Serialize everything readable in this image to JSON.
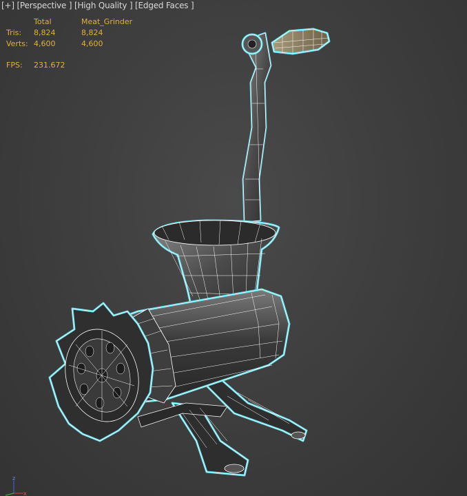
{
  "viewport": {
    "label_parts": [
      "[+]",
      "[Perspective ]",
      "[High Quality ]",
      "[Edged Faces ]"
    ]
  },
  "stats": {
    "header": {
      "total": "Total",
      "object": "Meat_Grinder"
    },
    "rows": [
      {
        "label": "Tris:",
        "total": "8,824",
        "object": "8,824"
      },
      {
        "label": "Verts:",
        "total": "4,600",
        "object": "4,600"
      }
    ],
    "fps": {
      "label": "FPS:",
      "value": "231.672"
    }
  },
  "gizmo": {
    "axes": [
      "z",
      "x"
    ]
  },
  "colors": {
    "background": "#3f3f3f",
    "stats_text": "#e0b23a",
    "selection_outline": "#5fd8e8",
    "wire": "#ffffff"
  }
}
